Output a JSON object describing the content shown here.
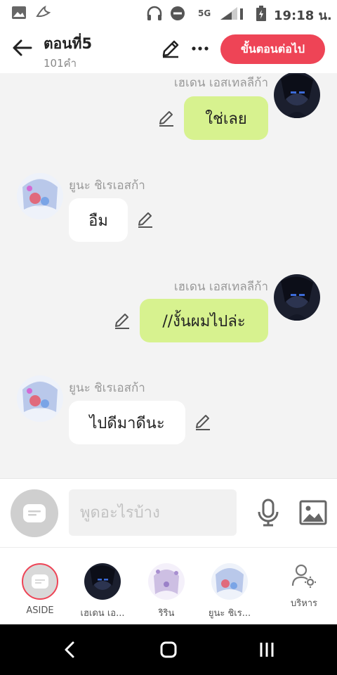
{
  "status_bar": {
    "network": "5G",
    "time": "19:18 น."
  },
  "header": {
    "title": "ตอนที่5",
    "subtitle": "101คำ",
    "next_label": "ขั้นตอนต่อไป"
  },
  "messages": [
    {
      "side": "right",
      "sender": "เฮเดน เอสเทลลีก้า",
      "text": "ใช่เลย"
    },
    {
      "side": "left",
      "sender": "ยูนะ ชิเรเอสก้า",
      "text": "อืม"
    },
    {
      "side": "right",
      "sender": "เฮเดน เอสเทลลีก้า",
      "text": "//งั้นผมไปล่ะ"
    },
    {
      "side": "left",
      "sender": "ยูนะ ชิเรเอสก้า",
      "text": "ไปดีมาดีนะ"
    }
  ],
  "input": {
    "placeholder": "พูดอะไรบ้าง"
  },
  "characters": [
    {
      "label": "ASIDE"
    },
    {
      "label": "เฮเดน เอ..."
    },
    {
      "label": "ริริน"
    },
    {
      "label": "ยูนะ ชิเร..."
    },
    {
      "label": "บริหาร"
    }
  ],
  "colors": {
    "accent_red": "#ee4456",
    "bubble_green": "#d7f28f",
    "bubble_white": "#ffffff"
  },
  "icons": {
    "back": "arrow-left-icon",
    "edit": "pencil-icon",
    "more": "more-horizontal-icon",
    "mic": "microphone-icon",
    "image": "image-icon",
    "manage": "user-gear-icon"
  }
}
